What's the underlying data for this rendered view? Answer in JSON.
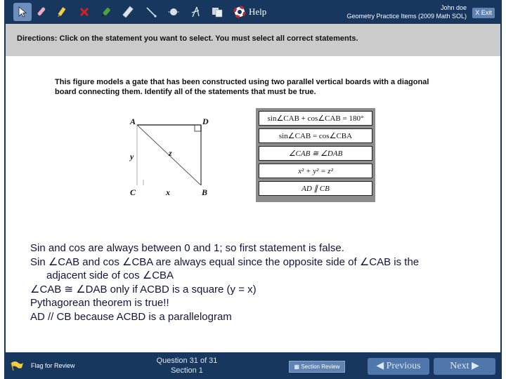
{
  "toolbar": {
    "tools": [
      {
        "name": "pointer",
        "icon": "arrow-pointer-icon",
        "active": true
      },
      {
        "name": "eraser",
        "icon": "eraser-icon"
      },
      {
        "name": "highlighter",
        "icon": "highlighter-icon"
      },
      {
        "name": "eliminate",
        "icon": "x-mark-icon"
      },
      {
        "name": "pencil",
        "icon": "pencil-icon"
      },
      {
        "name": "ruler",
        "icon": "ruler-icon"
      },
      {
        "name": "line",
        "icon": "line-icon"
      },
      {
        "name": "point",
        "icon": "point-icon"
      },
      {
        "name": "compass",
        "icon": "compass-icon"
      },
      {
        "name": "calculator",
        "icon": "reference-sheet-icon"
      }
    ],
    "help_label": "Help",
    "user_name": "John doe",
    "test_name": "Geometry Practice Items (2009 Math SOL)",
    "exit_label": "X Exit"
  },
  "directions": "Directions: Click on the statement you want to select. You must select all correct statements.",
  "question": {
    "stem": "This figure models a gate that has been constructed using two parallel vertical boards with a diagonal board connecting them. Identify all of the statements that must be true.",
    "figure_labels": {
      "A": "A",
      "D": "D",
      "C": "C",
      "B": "B",
      "x": "x",
      "y": "y",
      "z": "z"
    },
    "choices": [
      "sin∠CAB + cos∠CAB = 180°",
      "sin∠CAB = cos∠CBA",
      "∠CAB ≅ ∠DAB",
      "x² + y² = z²",
      "AD ∥ CB"
    ]
  },
  "notes": [
    "Sin and cos are always between 0 and 1; so first statement is false.",
    "Sin ∠CAB and cos ∠CBA are always equal since the opposite side of ∠CAB is the",
    "adjacent side of cos ∠CBA",
    "∠CAB ≅ ∠DAB only if ACBD is a square (y = x)",
    "Pythagorean theorem is true!!",
    "AD // CB because ACBD is a parallelogram"
  ],
  "footer": {
    "flag_label": "Flag for Review",
    "question_counter": "Question 31 of 31",
    "section": "Section 1",
    "section_review_label": "Section Review",
    "previous_label": "◀ Previous",
    "next_label": "Next ▶"
  }
}
